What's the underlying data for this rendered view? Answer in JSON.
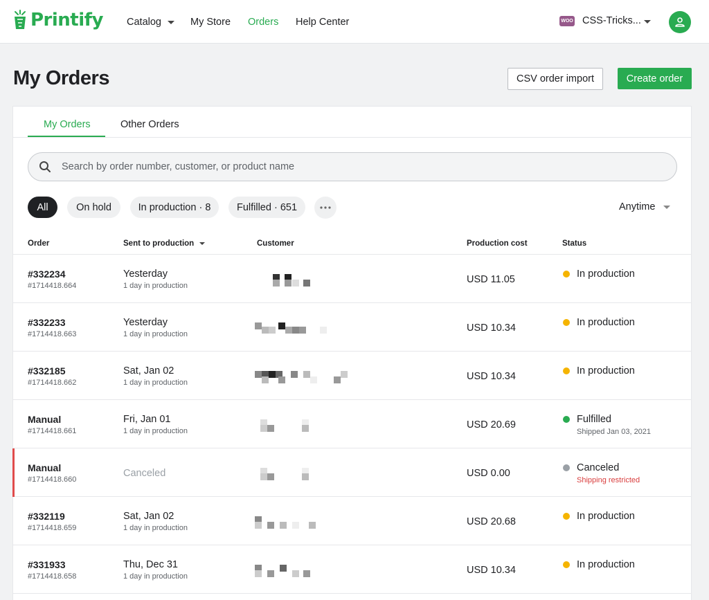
{
  "brand": {
    "name": "Printify",
    "color": "#29ab51"
  },
  "nav": {
    "catalog": "Catalog",
    "my_store": "My Store",
    "orders": "Orders",
    "help": "Help Center"
  },
  "store": {
    "badge": "WOO",
    "name": "CSS-Tricks..."
  },
  "page": {
    "title": "My Orders",
    "csv_import": "CSV order import",
    "create_order": "Create order"
  },
  "tabs": {
    "my_orders": "My Orders",
    "other_orders": "Other Orders"
  },
  "search": {
    "placeholder": "Search by order number, customer, or product name"
  },
  "filters": {
    "all": "All",
    "on_hold": "On hold",
    "in_production": "In production · 8",
    "fulfilled": "Fulfilled · 651",
    "date": "Anytime"
  },
  "columns": {
    "order": "Order",
    "sent": "Sent to production",
    "customer": "Customer",
    "cost": "Production cost",
    "status": "Status"
  },
  "colors": {
    "in_production": "#f5b400",
    "fulfilled": "#29ab51",
    "canceled": "#9aa0a6",
    "error": "#d93d3d"
  },
  "orders": [
    {
      "number": "#332234",
      "id": "#1714418.664",
      "sent": "Yesterday",
      "sent_sub": "1 day in production",
      "cost": "USD 11.05",
      "status": "In production",
      "status_sub": ""
    },
    {
      "number": "#332233",
      "id": "#1714418.663",
      "sent": "Yesterday",
      "sent_sub": "1 day in production",
      "cost": "USD 10.34",
      "status": "In production",
      "status_sub": ""
    },
    {
      "number": "#332185",
      "id": "#1714418.662",
      "sent": "Sat, Jan 02",
      "sent_sub": "1 day in production",
      "cost": "USD 10.34",
      "status": "In production",
      "status_sub": ""
    },
    {
      "number": "Manual",
      "id": "#1714418.661",
      "sent": "Fri, Jan 01",
      "sent_sub": "1 day in production",
      "cost": "USD 20.69",
      "status": "Fulfilled",
      "status_sub": "Shipped Jan 03, 2021"
    },
    {
      "number": "Manual",
      "id": "#1714418.660",
      "sent": "Canceled",
      "sent_sub": "",
      "cost": "USD 0.00",
      "status": "Canceled",
      "status_sub": "Shipping restricted"
    },
    {
      "number": "#332119",
      "id": "#1714418.659",
      "sent": "Sat, Jan 02",
      "sent_sub": "1 day in production",
      "cost": "USD 20.68",
      "status": "In production",
      "status_sub": ""
    },
    {
      "number": "#331933",
      "id": "#1714418.658",
      "sent": "Thu, Dec 31",
      "sent_sub": "1 day in production",
      "cost": "USD 10.34",
      "status": "In production",
      "status_sub": ""
    }
  ]
}
